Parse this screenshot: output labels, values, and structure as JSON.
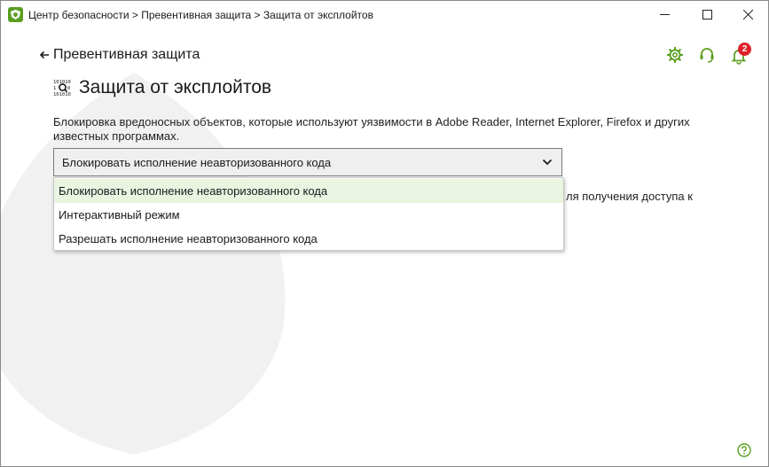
{
  "window": {
    "title": "Центр безопасности > Превентивная защита > Защита от эксплойтов",
    "controls": {
      "minimize": "—",
      "maximize": "☐",
      "close": "✕"
    }
  },
  "nav": {
    "back_label": "Превентивная защита"
  },
  "header_icons": {
    "gear": "gear-icon",
    "support": "headset-icon",
    "bell": "bell-icon",
    "notification_count": "2"
  },
  "page": {
    "title": "Защита от эксплойтов",
    "description": "Блокировка вредоносных объектов, которые используют уязвимости в Adobe Reader, Internet Explorer, Firefox и других известных программах.",
    "partially_hidden_text": "ля получения доступа к"
  },
  "mode_select": {
    "selected": "Блокировать исполнение неавторизованного кода",
    "options": [
      "Блокировать исполнение неавторизованного кода",
      "Интерактивный режим",
      "Разрешать исполнение неавторизованного кода"
    ]
  },
  "colors": {
    "accent_green": "#5a9e1f",
    "badge_red": "#e0202a",
    "selected_option_bg": "#e9f4e1"
  }
}
